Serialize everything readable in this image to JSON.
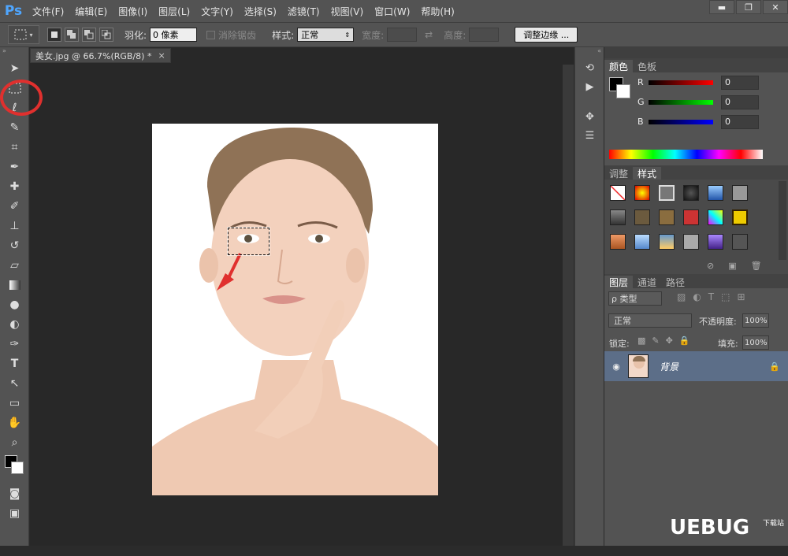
{
  "app": {
    "logo": "Ps"
  },
  "menu": [
    "文件(F)",
    "编辑(E)",
    "图像(I)",
    "图层(L)",
    "文字(Y)",
    "选择(S)",
    "滤镜(T)",
    "视图(V)",
    "窗口(W)",
    "帮助(H)"
  ],
  "window_controls": {
    "minimize": "▬",
    "restore": "❐",
    "close": "✕"
  },
  "options": {
    "feather_label": "羽化:",
    "feather_value": "0 像素",
    "antialias_label": "消除锯齿",
    "style_label": "样式:",
    "style_value": "正常",
    "width_label": "宽度:",
    "height_label": "高度:",
    "refine_button": "调整边缘 ..."
  },
  "document": {
    "tab_title": "美女.jpg @ 66.7%(RGB/8) *",
    "close": "×"
  },
  "color_panel": {
    "tabs": [
      "颜色",
      "色板"
    ],
    "channels": [
      {
        "name": "R",
        "value": "0",
        "color": "#d21c1c"
      },
      {
        "name": "G",
        "value": "0",
        "color": "#21b42a"
      },
      {
        "name": "B",
        "value": "0",
        "color": "#2834e0"
      }
    ]
  },
  "styles_panel": {
    "tabs": [
      "调整",
      "样式"
    ]
  },
  "layers_panel": {
    "tabs": [
      "图层",
      "通道",
      "路径"
    ],
    "filter": "ρ 类型",
    "blend_mode": "正常",
    "opacity_label": "不透明度:",
    "opacity_value": "100%",
    "lock_label": "锁定:",
    "fill_label": "填充:",
    "fill_value": "100%",
    "layer_name": "背景"
  },
  "watermark": {
    "main": "UEBUG",
    "sub": "下载站"
  },
  "colors": {
    "accent": "#4fa6ff",
    "annotation": "#e0302e",
    "selected_layer": "#5c6e88"
  }
}
